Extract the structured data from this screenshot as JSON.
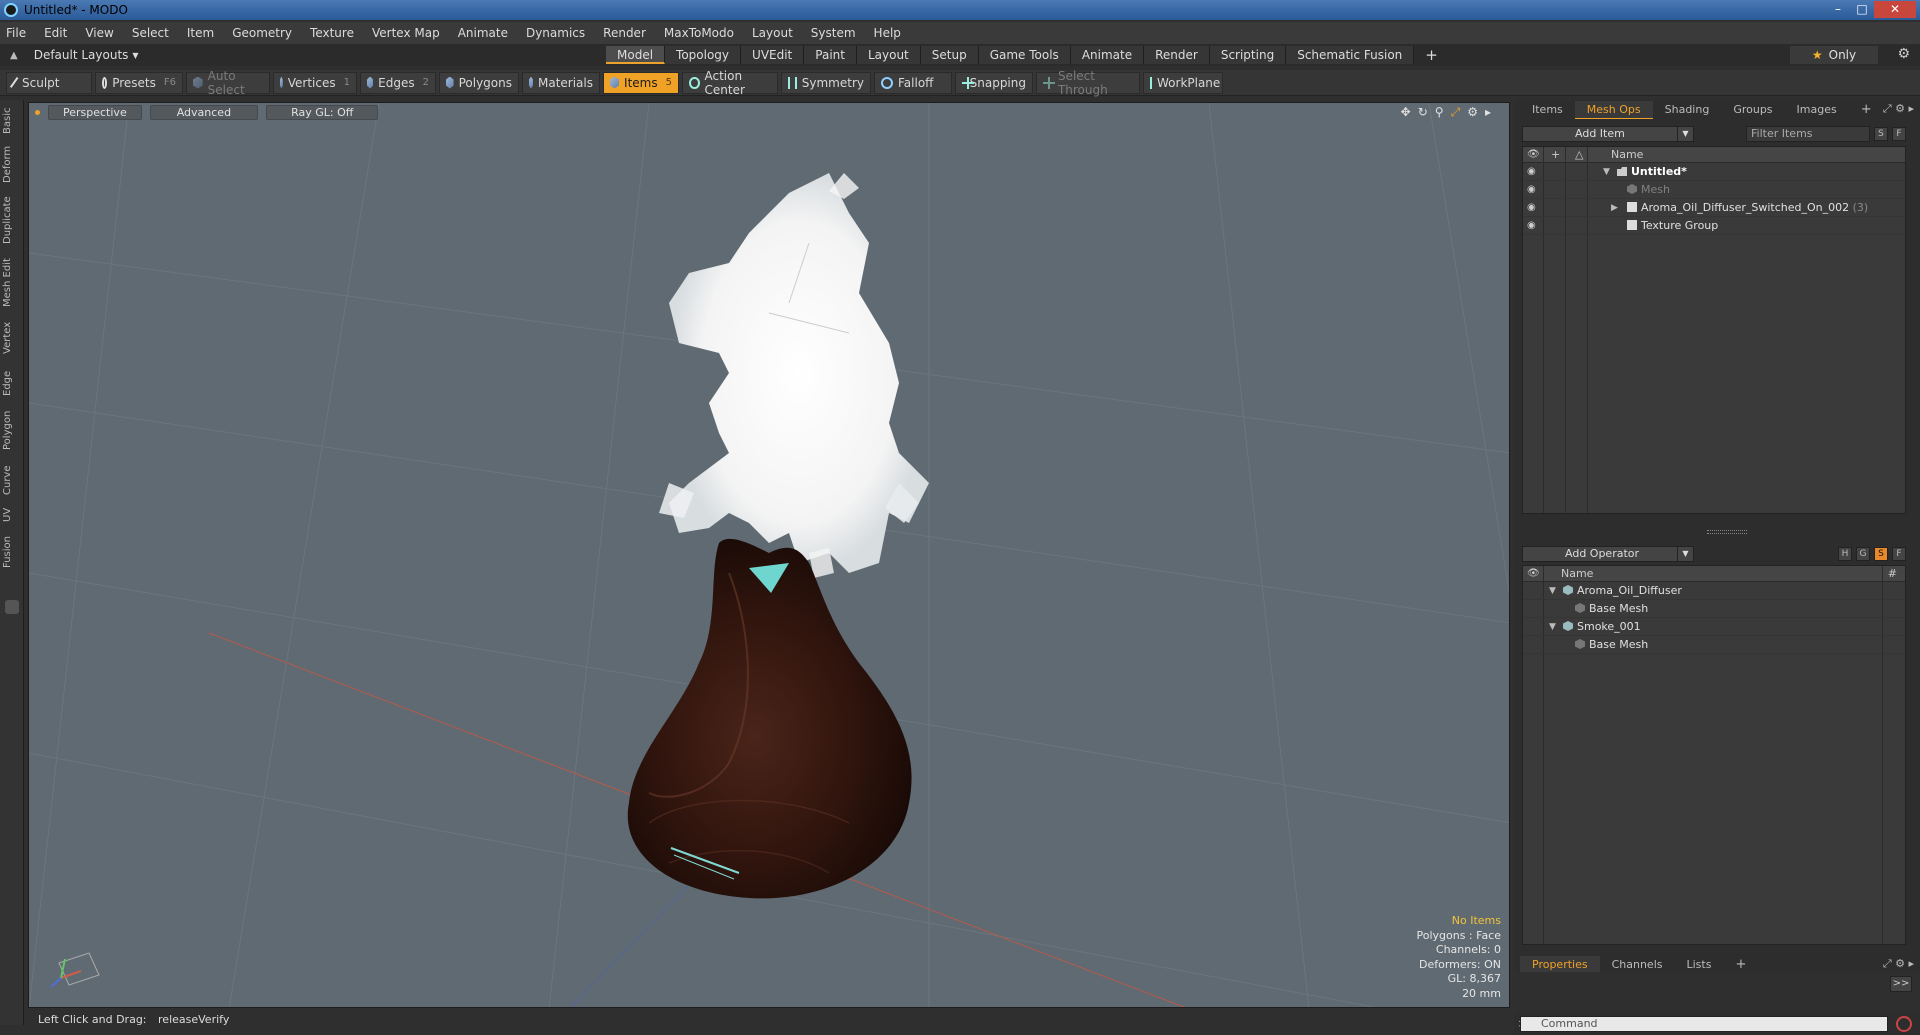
{
  "window": {
    "title": "Untitled* - MODO"
  },
  "menu": [
    "File",
    "Edit",
    "View",
    "Select",
    "Item",
    "Geometry",
    "Texture",
    "Vertex Map",
    "Animate",
    "Dynamics",
    "Render",
    "MaxToModo",
    "Layout",
    "System",
    "Help"
  ],
  "layout_bar": {
    "layout_select": "Default Layouts",
    "tabs": [
      "Model",
      "Topology",
      "UVEdit",
      "Paint",
      "Layout",
      "Setup",
      "Game Tools",
      "Animate",
      "Render",
      "Scripting",
      "Schematic Fusion"
    ],
    "active_tab": "Model",
    "only_label": "Only"
  },
  "toolbar": {
    "sculpt": "Sculpt",
    "presets": "Presets",
    "presets_key": "F6",
    "auto_select": "Auto Select",
    "vertices": "Vertices",
    "vertices_key": "1",
    "edges": "Edges",
    "edges_key": "2",
    "polygons": "Polygons",
    "materials": "Materials",
    "items": "Items",
    "items_key": "5",
    "action_center": "Action Center",
    "symmetry": "Symmetry",
    "falloff": "Falloff",
    "snapping": "Snapping",
    "select_through": "Select Through",
    "workplane": "WorkPlane"
  },
  "left_tabs": [
    "Basic",
    "Deform",
    "Duplicate",
    "Mesh Edit",
    "Vertex",
    "Edge",
    "Polygon",
    "Curve",
    "UV",
    "Fusion"
  ],
  "viewport": {
    "view_mode": "Perspective",
    "shading": "Advanced",
    "raygl": "Ray GL: Off",
    "info": {
      "selection": "No Items",
      "polygons": "Polygons : Face",
      "channels": "Channels: 0",
      "deformers": "Deformers: ON",
      "gl": "GL: 8,367",
      "unit": "20 mm"
    }
  },
  "status": {
    "hint": "Left Click and Drag:",
    "action": "releaseVerify"
  },
  "items_panel": {
    "tabs": [
      "Items",
      "Mesh Ops",
      "Shading",
      "Groups",
      "Images"
    ],
    "active_tab": "Mesh Ops",
    "add_item": "Add Item",
    "filter": "Filter Items",
    "btn_s": "S",
    "btn_f": "F",
    "col_name": "Name",
    "rows": [
      {
        "label": "Untitled*",
        "count": ""
      },
      {
        "label": "Mesh",
        "count": ""
      },
      {
        "label": "Aroma_Oil_Diffuser_Switched_On_002",
        "count": "(3)"
      },
      {
        "label": "Texture Group",
        "count": ""
      }
    ]
  },
  "meshops_panel": {
    "add_operator": "Add Operator",
    "btn_h": "H",
    "btn_g": "G",
    "btn_s": "S",
    "btn_f": "F",
    "col_name": "Name",
    "col_hash": "#",
    "rows": [
      {
        "label": "Aroma_Oil_Diffuser"
      },
      {
        "label": "Base Mesh"
      },
      {
        "label": "Smoke_001"
      },
      {
        "label": "Base Mesh"
      }
    ]
  },
  "props_panel": {
    "tabs": [
      "Properties",
      "Channels",
      "Lists"
    ],
    "active_tab": "Properties",
    "expand": ">>"
  },
  "command": {
    "prompt": ">",
    "placeholder": "Command"
  },
  "colors": {
    "accent": "#f0a227",
    "viewport_bg": "#5f6a72",
    "wood": "#3a1d14"
  }
}
